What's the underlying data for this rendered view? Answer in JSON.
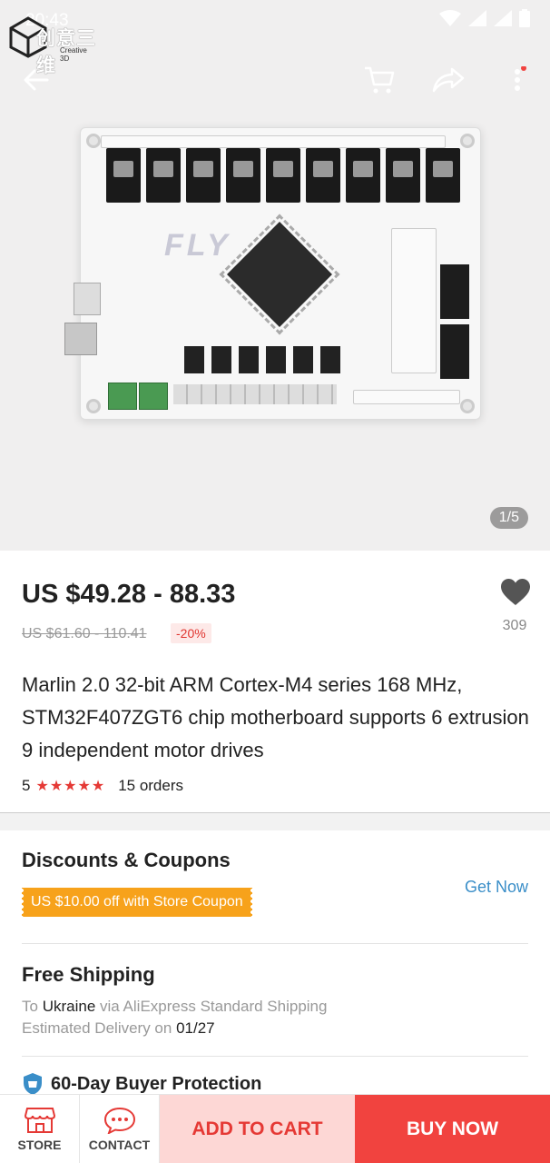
{
  "status": {
    "time": "20:43"
  },
  "brand": {
    "logo_cn": "创意三维",
    "logo_en": "Creative 3D"
  },
  "gallery": {
    "counter": "1/5",
    "board_label": "FLY"
  },
  "product": {
    "price": "US $49.28 - 88.33",
    "old_price": "US $61.60 - 110.41",
    "discount": "-20%",
    "wishlist_count": "309",
    "title": "Marlin 2.0 32-bit ARM Cortex-M4 series 168 MHz, STM32F407ZGT6 chip motherboard supports 6 extrusion 9 independent motor drives",
    "rating": "5",
    "stars": "★★★★★",
    "orders": "15 orders"
  },
  "discounts": {
    "title": "Discounts & Coupons",
    "coupon": "US $10.00 off with Store Coupon",
    "get_now": "Get Now"
  },
  "shipping": {
    "title": "Free Shipping",
    "to_label": "To",
    "country": "Ukraine",
    "via": "via AliExpress Standard Shipping",
    "eta_label": "Estimated Delivery on",
    "eta_date": "01/27"
  },
  "protection": {
    "title": "60-Day Buyer Protection"
  },
  "bottom_bar": {
    "store": "STORE",
    "contact": "CONTACT",
    "add_to_cart": "ADD TO CART",
    "buy_now": "BUY NOW"
  },
  "colors": {
    "accent": "#f1433f",
    "coupon": "#f7a21b",
    "link": "#3a8ec8"
  }
}
